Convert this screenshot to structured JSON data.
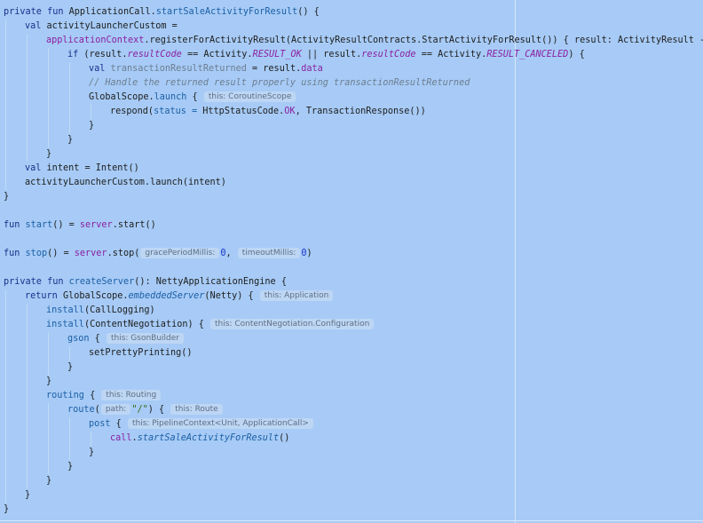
{
  "code": {
    "l1": {
      "kw": "private fun ",
      "recv": "ApplicationCall.",
      "name": "startSaleActivityForResult",
      "rest": "() {"
    },
    "l2": {
      "kw": "val ",
      "rest": "activityLauncherCustom ="
    },
    "l3": {
      "obj": "applicationContext",
      "rest": ".registerForActivityResult(ActivityResultContracts.StartActivityForResult()) { result: ActivityResult ->"
    },
    "l4": {
      "kw": "if ",
      "a": "(result.",
      "p1": "resultCode",
      "b": " == Activity.",
      "c1": "RESULT_OK",
      "c": " || result.",
      "p2": "resultCode",
      "d": " == Activity.",
      "c2": "RESULT_CANCELED",
      "e": ") {"
    },
    "l5": {
      "kw": "val ",
      "var": "transactionResultReturned",
      "b": " = result.",
      "p": "data"
    },
    "l6": {
      "comment": "// Handle the returned result properly using transactionResultReturned"
    },
    "l7": {
      "a": "GlobalScope.",
      "fn": "launch",
      "b": " {",
      "hint": "this: CoroutineScope"
    },
    "l8": {
      "a": "respond(",
      "named": "status = ",
      "b": "HttpStatusCode.",
      "c": "OK",
      "d": ", TransactionResponse())"
    },
    "l9": "}",
    "l10": "}",
    "l11": "}",
    "l12": {
      "kw": "val ",
      "rest": "intent = Intent()"
    },
    "l13": "activityLauncherCustom.launch(intent)",
    "l14": "}",
    "l16": {
      "kw": "fun ",
      "name": "start",
      "a": "() = ",
      "obj": "server",
      "b": ".start()"
    },
    "l18": {
      "kw": "fun ",
      "name": "stop",
      "a": "() = ",
      "obj": "server",
      "b": ".stop(",
      "hint1": "gracePeriodMillis:",
      "n1": "0",
      "c": ", ",
      "hint2": "timeoutMillis:",
      "n2": "0",
      "d": ")"
    },
    "l20": {
      "kw": "private fun ",
      "name": "createServer",
      "rest": "(): NettyApplicationEngine {"
    },
    "l21": {
      "kw": "return ",
      "a": "GlobalScope.",
      "fn": "embeddedServer",
      "b": "(Netty) {",
      "hint": "this: Application"
    },
    "l22": {
      "fn": "install",
      "rest": "(CallLogging)"
    },
    "l23": {
      "fn": "install",
      "rest": "(ContentNegotiation) {",
      "hint": "this: ContentNegotiation.Configuration"
    },
    "l24": {
      "fn": "gson",
      "rest": " {",
      "hint": "this: GsonBuilder"
    },
    "l25": "setPrettyPrinting()",
    "l26": "}",
    "l27": "}",
    "l28": {
      "fn": "routing",
      "rest": " {",
      "hint": "this: Routing"
    },
    "l29": {
      "fn": "route",
      "a": "(",
      "hint1": "path:",
      "str": "\"/\"",
      "b": ") {",
      "hint2": "this: Route"
    },
    "l30": {
      "fn": "post",
      "rest": " {",
      "hint": "this: PipelineContext<Unit, ApplicationCall>"
    },
    "l31": {
      "obj": "call",
      "a": ".",
      "fn": "startSaleActivityForResult",
      "b": "()"
    },
    "l32": "}",
    "l33": "}",
    "l34": "}",
    "l35": "}"
  }
}
